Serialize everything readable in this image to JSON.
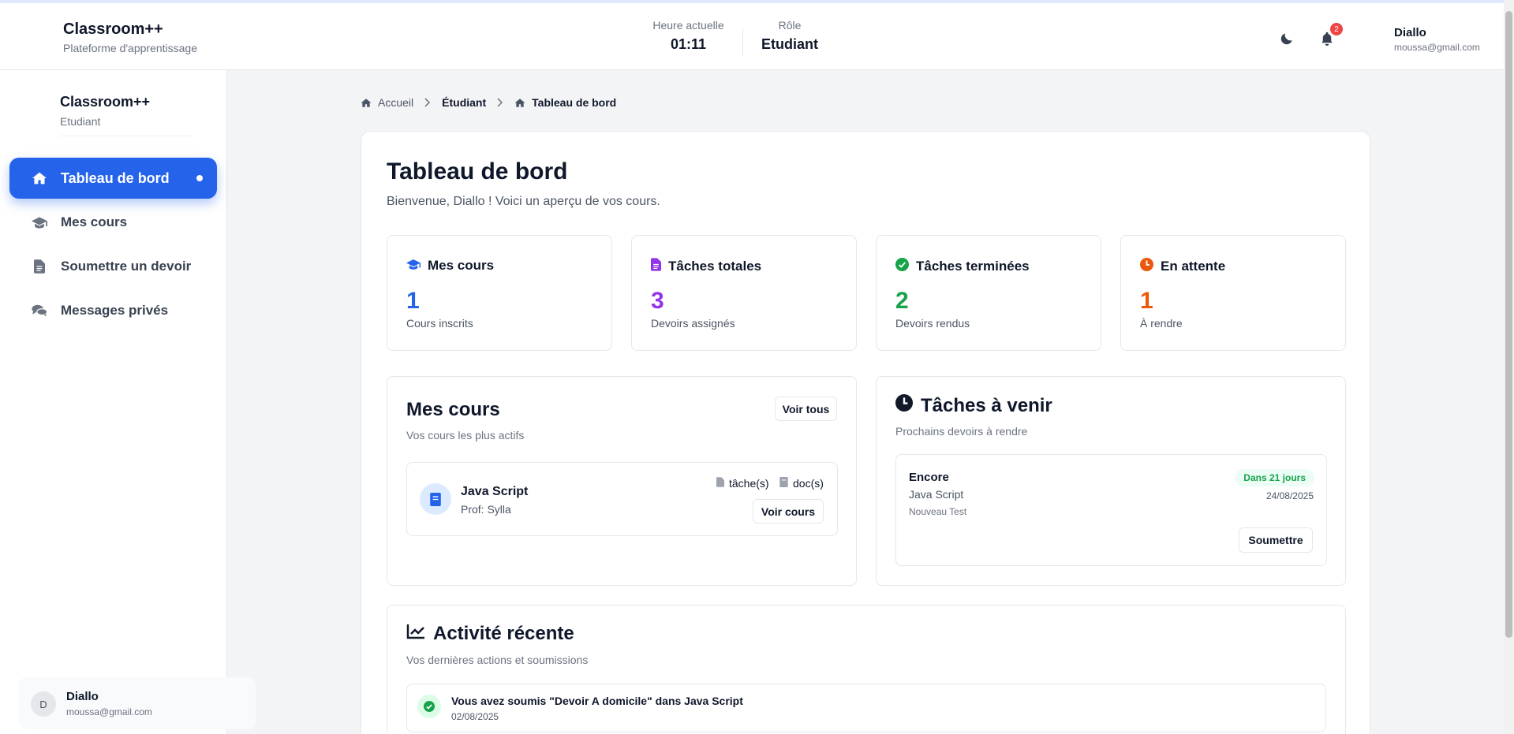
{
  "header": {
    "brand_title": "Classroom++",
    "brand_subtitle": "Plateforme d'apprentissage",
    "time_label": "Heure actuelle",
    "time_value": "01:11",
    "role_label": "Rôle",
    "role_value": "Etudiant",
    "notif_count": "2",
    "user_name": "Diallo",
    "user_email": "moussa@gmail.com"
  },
  "sidebar": {
    "brand_title": "Classroom++",
    "brand_role": "Etudiant",
    "items": [
      {
        "label": "Tableau de bord",
        "icon": "home-icon",
        "active": true
      },
      {
        "label": "Mes cours",
        "icon": "graduation-cap-icon"
      },
      {
        "label": "Soumettre un devoir",
        "icon": "file-icon"
      },
      {
        "label": "Messages privés",
        "icon": "comments-icon"
      }
    ],
    "user": {
      "initial": "D",
      "name": "Diallo",
      "email": "moussa@gmail.com"
    }
  },
  "breadcrumb": [
    "Accueil",
    "Étudiant",
    "Tableau de bord"
  ],
  "page": {
    "title": "Tableau de bord",
    "subtitle": "Bienvenue, Diallo ! Voici un aperçu de vos cours."
  },
  "stats": [
    {
      "title": "Mes cours",
      "value": "1",
      "caption": "Cours inscrits",
      "color": "#2563eb",
      "icon": "graduation-cap-icon"
    },
    {
      "title": "Tâches totales",
      "value": "3",
      "caption": "Devoirs assignés",
      "color": "#9333ea",
      "icon": "file-icon"
    },
    {
      "title": "Tâches terminées",
      "value": "2",
      "caption": "Devoirs rendus",
      "color": "#16a34a",
      "icon": "check-circle-icon"
    },
    {
      "title": "En attente",
      "value": "1",
      "caption": "À rendre",
      "color": "#ea580c",
      "icon": "clock-icon"
    }
  ],
  "courses": {
    "title": "Mes cours",
    "subtitle": "Vos cours les plus actifs",
    "see_all": "Voir tous",
    "items": [
      {
        "name": "Java Script",
        "teacher": "Prof: Sylla",
        "tasks": "tâche(s)",
        "docs": "doc(s)",
        "action": "Voir cours"
      }
    ]
  },
  "upcoming": {
    "title": "Tâches à venir",
    "subtitle": "Prochains devoirs à rendre",
    "items": [
      {
        "name": "Encore",
        "course": "Java Script",
        "desc": "Nouveau Test",
        "badge": "Dans 21 jours",
        "date": "24/08/2025",
        "action": "Soumettre"
      }
    ]
  },
  "activity": {
    "title": "Activité récente",
    "subtitle": "Vos dernières actions et soumissions",
    "items": [
      {
        "text": "Vous avez soumis \"Devoir A domicile\" dans Java Script",
        "date": "02/08/2025"
      }
    ]
  }
}
